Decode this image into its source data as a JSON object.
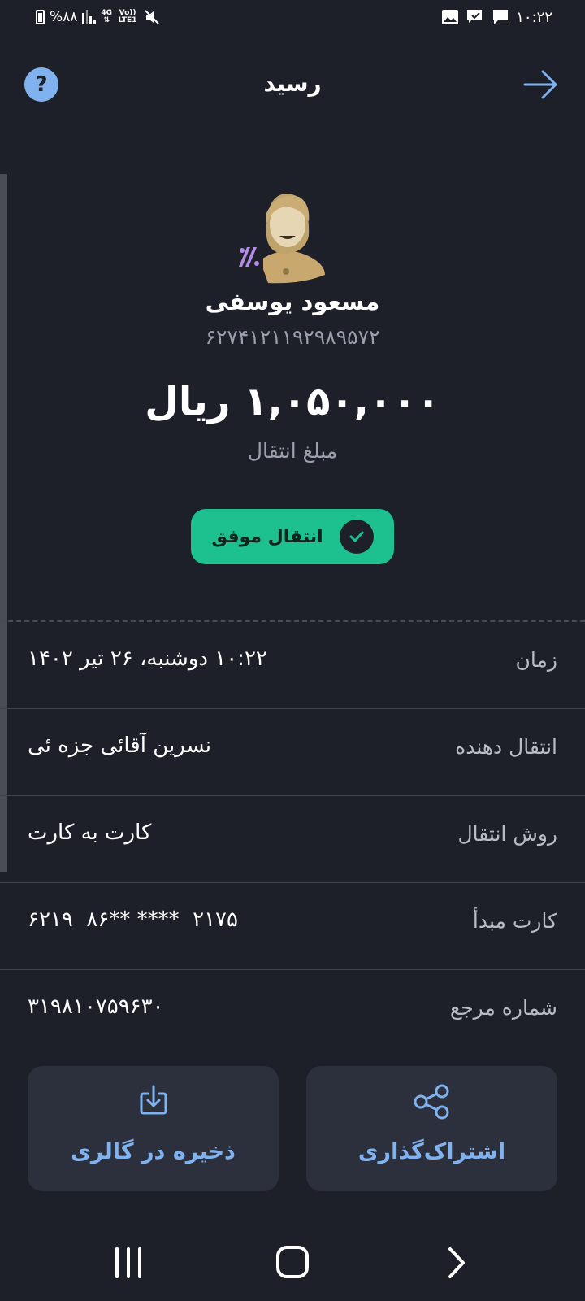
{
  "status_bar": {
    "battery_text": "%۸۸",
    "network_label_top": "4G",
    "volte_label": "Vo)) LTE1",
    "time": "۱۰:۲۲"
  },
  "header": {
    "title": "رسید",
    "help_symbol": "?"
  },
  "recipient": {
    "name": "مسعود یوسفی",
    "card_number": "۶۲۷۴۱۲۱۱۹۲۹۸۹۵۷۲"
  },
  "amount": {
    "value": "۱,۰۵۰,۰۰۰ ریال",
    "caption": "مبلغ انتقال"
  },
  "status": {
    "label": "انتقال موفق",
    "color": "#1dc08f"
  },
  "details": [
    {
      "label": "زمان",
      "value": "۱۰:۲۲ دوشنبه، ۲۶ تیر ۱۴۰۲"
    },
    {
      "label": "انتقال دهنده",
      "value": "نسرین آقائی جزه ئی"
    },
    {
      "label": "روش انتقال",
      "value": "کارت به کارت"
    },
    {
      "label": "کارت مبدأ",
      "value": "۶۲۱۹  ۸۶** ****  ۲۱۷۵"
    },
    {
      "label": "شماره مرجع",
      "value": "۳۱۹۸۱۰۷۵۹۶۳۰"
    }
  ],
  "actions": {
    "save_label": "ذخیره در گالری",
    "share_label": "اشتراک‌گذاری"
  },
  "colors": {
    "background": "#1d2029",
    "accent": "#7fb2ee",
    "success": "#1dc08f"
  },
  "icons": {
    "help": "question-icon",
    "back": "arrow-right-icon",
    "save": "download-icon",
    "share": "share-icon",
    "check": "check-icon"
  }
}
